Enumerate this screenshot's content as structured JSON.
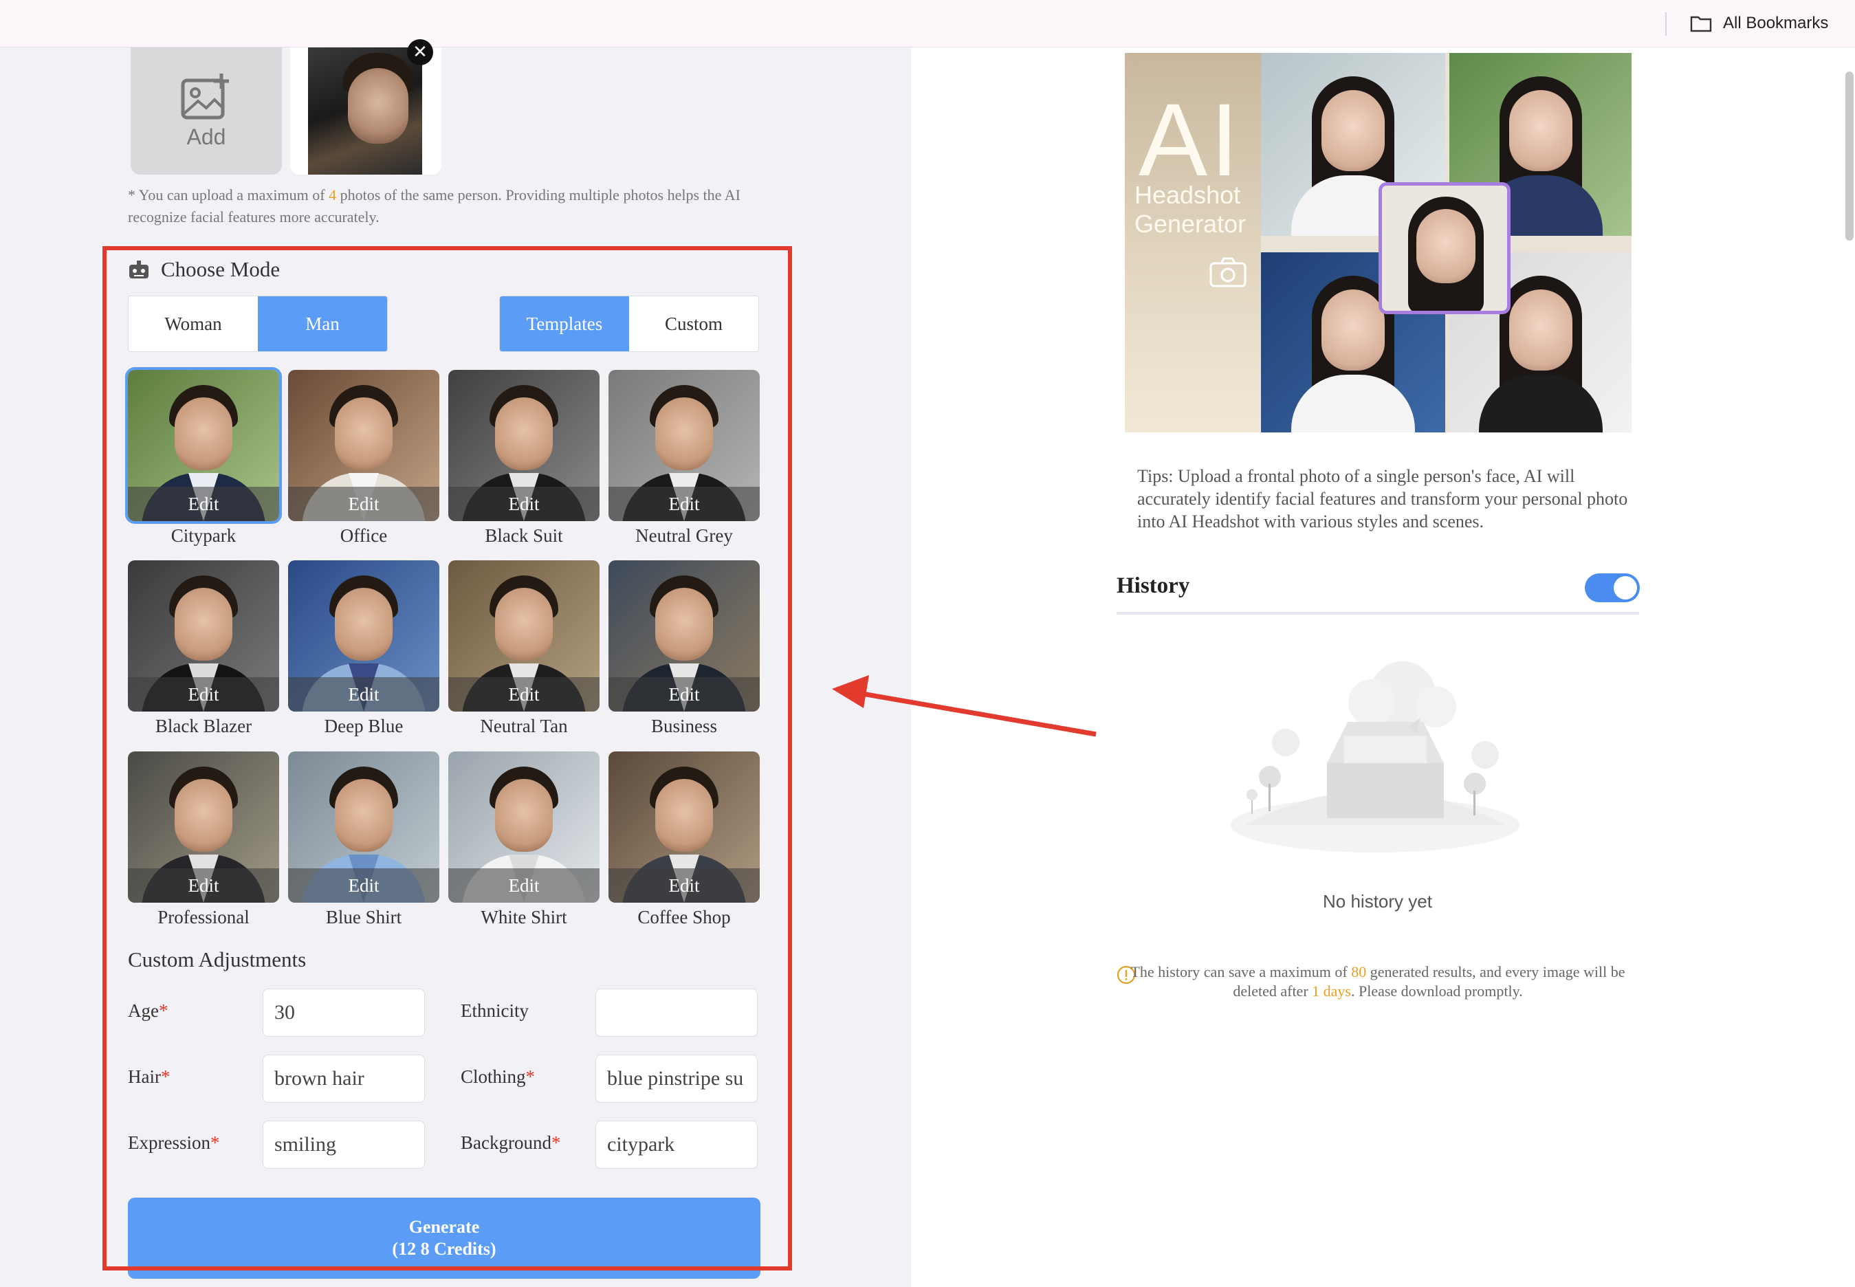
{
  "topbar": {
    "bookmarks_label": "All Bookmarks",
    "folder_icon": "folder-icon"
  },
  "upload": {
    "add_label": "Add",
    "note_prefix": "* You can upload a maximum of ",
    "note_count": "4",
    "note_suffix": " photos of the same person. Providing multiple photos helps the AI recognize facial features more accurately."
  },
  "mode": {
    "title": "Choose Mode",
    "genders": [
      "Woman",
      "Man"
    ],
    "selected_gender": "Man",
    "modes": [
      "Templates",
      "Custom"
    ],
    "selected_mode": "Templates"
  },
  "templates": {
    "edit_label": "Edit",
    "items": [
      {
        "label": "Citypark"
      },
      {
        "label": "Office"
      },
      {
        "label": "Black Suit"
      },
      {
        "label": "Neutral Grey"
      },
      {
        "label": "Black Blazer"
      },
      {
        "label": "Deep Blue"
      },
      {
        "label": "Neutral Tan"
      },
      {
        "label": "Business"
      },
      {
        "label": "Professional"
      },
      {
        "label": "Blue Shirt"
      },
      {
        "label": "White Shirt"
      },
      {
        "label": "Coffee Shop"
      }
    ],
    "selected": "Citypark"
  },
  "adjustments": {
    "title": "Custom Adjustments",
    "age_label": "Age",
    "age_value": "30",
    "ethnicity_label": "Ethnicity",
    "ethnicity_value": "",
    "hair_label": "Hair",
    "hair_value": "brown hair",
    "clothing_label": "Clothing",
    "clothing_value": "blue pinstripe su",
    "expression_label": "Expression",
    "expression_value": "smiling",
    "background_label": "Background",
    "background_value": "citypark",
    "required_mark": "*"
  },
  "generate": {
    "line1": "Generate",
    "line2": "(12 8 Credits)"
  },
  "promo": {
    "big": "AI",
    "line1": "Headshot",
    "line2": "Generator"
  },
  "tips": "Tips: Upload a frontal photo of a single person's face, AI will accurately identify facial features and transform your personal photo into AI Headshot with various styles and scenes.",
  "history": {
    "title": "History",
    "toggle_on": true,
    "empty_text": "No history yet",
    "note_prefix": "The history can save a maximum of ",
    "note_max": "80",
    "note_mid": " generated results, and every image will be deleted after ",
    "note_days": "1 days",
    "note_suffix": ". Please download promptly."
  },
  "colors": {
    "accent": "#5b9cf6",
    "highlight": "#e23b2e",
    "warning": "#e8a020"
  }
}
